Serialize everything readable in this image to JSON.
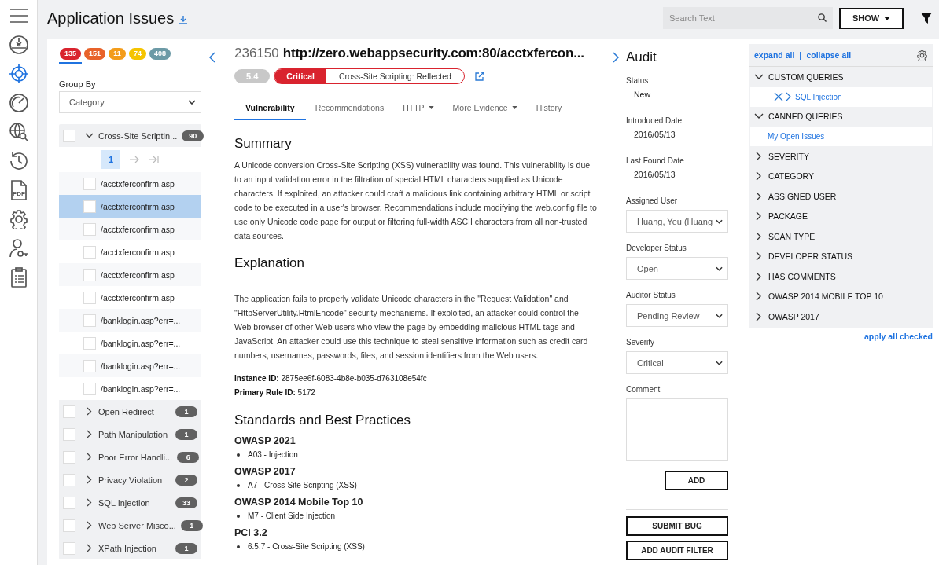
{
  "sidebar": {
    "items": [
      {
        "kind": "menu",
        "selected": false
      },
      {
        "kind": "dashboard",
        "selected": false
      },
      {
        "kind": "target",
        "selected": true
      },
      {
        "kind": "gauge",
        "selected": false
      },
      {
        "kind": "globe-search",
        "selected": false
      },
      {
        "kind": "history",
        "selected": false
      },
      {
        "kind": "pdf",
        "text": "PDF",
        "selected": false
      },
      {
        "kind": "settings",
        "selected": false
      },
      {
        "kind": "user-key",
        "selected": false
      },
      {
        "kind": "clipboard",
        "selected": false
      }
    ]
  },
  "header": {
    "title": "Application Issues",
    "search": {
      "placeholder": "Search Text"
    },
    "show_button": "SHOW"
  },
  "severity_counts": [
    {
      "count": "135",
      "color": "#d9232e",
      "selected": true
    },
    {
      "count": "151",
      "color": "#e8622a",
      "selected": false
    },
    {
      "count": "11",
      "color": "#f39c1a",
      "selected": false
    },
    {
      "count": "74",
      "color": "#f5c400",
      "selected": false
    },
    {
      "count": "408",
      "color": "#6c9aa6",
      "selected": false
    }
  ],
  "group_by": {
    "label": "Group By",
    "value": "Category"
  },
  "groups": [
    {
      "name": "Cross-Site Scriptin...",
      "count": "90",
      "expanded": true,
      "checked": false,
      "pager": {
        "current": "1"
      },
      "children": [
        {
          "name": "/acctxferconfirm.asp",
          "checked": false,
          "selected": false
        },
        {
          "name": "/acctxferconfirm.asp",
          "checked": false,
          "selected": true
        },
        {
          "name": "/acctxferconfirm.asp",
          "checked": false,
          "selected": false
        },
        {
          "name": "/acctxferconfirm.asp",
          "checked": false,
          "selected": false
        },
        {
          "name": "/acctxferconfirm.asp",
          "checked": false,
          "selected": false
        },
        {
          "name": "/acctxferconfirm.asp",
          "checked": false,
          "selected": false
        },
        {
          "name": "/banklogin.asp?err=...",
          "checked": false,
          "selected": false
        },
        {
          "name": "/banklogin.asp?err=...",
          "checked": false,
          "selected": false
        },
        {
          "name": "/banklogin.asp?err=...",
          "checked": false,
          "selected": false
        },
        {
          "name": "/banklogin.asp?err=...",
          "checked": false,
          "selected": false
        }
      ]
    },
    {
      "name": "Open Redirect",
      "count": "1",
      "expanded": false,
      "checked": false
    },
    {
      "name": "Path Manipulation",
      "count": "1",
      "expanded": false,
      "checked": false
    },
    {
      "name": "Poor Error Handli...",
      "count": "6",
      "expanded": false,
      "checked": false
    },
    {
      "name": "Privacy Violation",
      "count": "2",
      "expanded": false,
      "checked": false
    },
    {
      "name": "SQL Injection",
      "count": "33",
      "expanded": false,
      "checked": false
    },
    {
      "name": "Web Server Misco...",
      "count": "1",
      "expanded": false,
      "checked": false
    },
    {
      "name": "XPath Injection",
      "count": "1",
      "expanded": false,
      "checked": false
    }
  ],
  "issue": {
    "id": "236150",
    "url": "http://zero.webappsecurity.com:80/acctxfercon...",
    "score": "5.4",
    "severity": "Critical",
    "category": "Cross-Site Scripting: Reflected"
  },
  "tabs": [
    {
      "label": "Vulnerability",
      "selected": true,
      "dropdown": false
    },
    {
      "label": "Recommendations",
      "selected": false,
      "dropdown": false
    },
    {
      "label": "HTTP",
      "selected": false,
      "dropdown": true
    },
    {
      "label": "More Evidence",
      "selected": false,
      "dropdown": true
    },
    {
      "label": "History",
      "selected": false,
      "dropdown": false
    }
  ],
  "details": {
    "summary": {
      "heading": "Summary",
      "text": "A Unicode conversion Cross-Site Scripting (XSS) vulnerability was found. This vulnerability is due to an input validation error in the filtration of special HTML characters supplied as Unicode characters. If exploited, an attacker could craft a malicious link containing arbitrary HTML or script code to be executed in a user's browser. Recommendations include modifying the web.config file to use only Unicode code page for output or filtering full-width ASCII characters from all non-trusted data sources."
    },
    "explanation": {
      "heading": "Explanation",
      "text": "The application fails to properly validate Unicode characters in the \"Request Validation\" and \"HttpServerUtility.HtmlEncode\" security mechanisms. If exploited, an attacker could control the Web browser of other Web users who view the page by embedding malicious HTML tags and JavaScript. An attacker could use this technique to steal sensitive information such as credit card numbers, usernames, passwords, files, and session identifiers from the Web users."
    },
    "ids": [
      "**Instance ID:** 2875ee6f-6083-4b8e-b035-d763108e54fc",
      "**Primary Rule ID:** 5172"
    ],
    "standards": {
      "heading": "Standards and Best Practices",
      "groups": [
        {
          "name": "OWASP 2021",
          "items": [
            "A03 - Injection"
          ]
        },
        {
          "name": "OWASP 2017",
          "items": [
            "A7 - Cross-Site Scripting (XSS)"
          ]
        },
        {
          "name": "OWASP 2014 Mobile Top 10",
          "items": [
            "M7 - Client Side Injection"
          ]
        },
        {
          "name": "PCI 3.2",
          "items": [
            "6.5.7 - Cross-Site Scripting (XSS)"
          ]
        }
      ]
    }
  },
  "audit": {
    "title": "Audit",
    "fields": [
      {
        "kind": "text",
        "label": "Status",
        "value": "New"
      },
      {
        "kind": "text",
        "label": "Introduced Date",
        "value": "2016/05/13"
      },
      {
        "kind": "text",
        "label": "Last Found Date",
        "value": "2016/05/13"
      },
      {
        "kind": "select",
        "label": "Assigned User",
        "value": "Huang, Yeu (Huang"
      },
      {
        "kind": "select",
        "label": "Developer Status",
        "value": "Open"
      },
      {
        "kind": "select",
        "label": "Auditor Status",
        "value": "Pending Review"
      },
      {
        "kind": "select",
        "label": "Severity",
        "value": "Critical"
      },
      {
        "kind": "textarea",
        "label": "Comment"
      }
    ],
    "add_button": "ADD",
    "buttons": [
      "SUBMIT BUG",
      "ADD AUDIT FILTER"
    ]
  },
  "filters": {
    "expand_all": "expand all",
    "separator": "|",
    "collapse_all": "collapse all",
    "sections": [
      {
        "name": "CUSTOM QUERIES",
        "expanded": true,
        "children": [
          {
            "name": "SQL Injection",
            "removable": true
          }
        ]
      },
      {
        "name": "CANNED QUERIES",
        "expanded": true,
        "children": [
          {
            "name": "My Open Issues",
            "removable": false
          }
        ]
      },
      {
        "name": "SEVERITY",
        "expanded": false
      },
      {
        "name": "CATEGORY",
        "expanded": false
      },
      {
        "name": "ASSIGNED USER",
        "expanded": false
      },
      {
        "name": "PACKAGE",
        "expanded": false
      },
      {
        "name": "SCAN TYPE",
        "expanded": false
      },
      {
        "name": "DEVELOPER STATUS",
        "expanded": false
      },
      {
        "name": "HAS COMMENTS",
        "expanded": false
      },
      {
        "name": "OWASP 2014 MOBILE TOP 10",
        "expanded": false
      },
      {
        "name": "OWASP 2017",
        "expanded": false
      }
    ],
    "apply": "apply all checked"
  }
}
